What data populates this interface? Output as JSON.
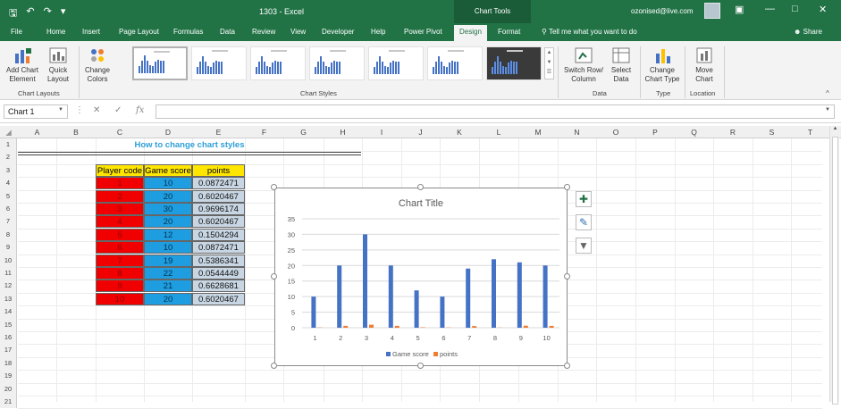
{
  "window": {
    "title": "1303 - Excel",
    "context_tab": "Chart Tools",
    "user_email": "ozonised@live.com",
    "share_label": "Share"
  },
  "tabs": [
    "File",
    "Home",
    "Insert",
    "Page Layout",
    "Formulas",
    "Data",
    "Review",
    "View",
    "Developer",
    "Help",
    "Power Pivot",
    "Design",
    "Format"
  ],
  "active_tab": "Design",
  "tell_me": "Tell me what you want to do",
  "ribbon": {
    "add_chart_element": "Add Chart Element",
    "quick_layout": "Quick Layout",
    "change_colors": "Change Colors",
    "group_chart_layouts": "Chart Layouts",
    "group_chart_styles": "Chart Styles",
    "switch_row_column": "Switch Row/ Column",
    "select_data": "Select Data",
    "group_data": "Data",
    "change_chart_type": "Change Chart Type",
    "group_type": "Type",
    "move_chart": "Move Chart",
    "group_location": "Location"
  },
  "formula_bar": {
    "name_box": "Chart 1",
    "fx": "fx",
    "formula": ""
  },
  "columns": [
    "A",
    "B",
    "C",
    "D",
    "E",
    "F",
    "G",
    "H",
    "I",
    "J",
    "K",
    "L",
    "M",
    "N",
    "O",
    "P",
    "Q",
    "R",
    "S",
    "T"
  ],
  "rows": [
    "1",
    "2",
    "3",
    "4",
    "5",
    "6",
    "7",
    "8",
    "9",
    "10",
    "11",
    "12",
    "13",
    "14",
    "15",
    "16",
    "17",
    "18",
    "19",
    "20",
    "21"
  ],
  "sheet": {
    "heading": "How to change chart styles",
    "headers": [
      "Player code",
      "Game score",
      "points"
    ],
    "player_codes": [
      "1",
      "2",
      "3",
      "4",
      "5",
      "6",
      "7",
      "8",
      "9",
      "10"
    ],
    "game_scores": [
      "10",
      "20",
      "30",
      "20",
      "12",
      "10",
      "19",
      "22",
      "21",
      "20"
    ],
    "points": [
      "0.0872471",
      "0.6020467",
      "0.9696174",
      "0.6020467",
      "0.1504294",
      "0.0872471",
      "0.5386341",
      "0.0544449",
      "0.6628681",
      "0.6020467"
    ]
  },
  "colors": {
    "excel_green": "#217346",
    "series_game_score": "#4472c4",
    "series_points": "#ed7d31",
    "header_fill": "#ffe600",
    "player_fill": "#f00000",
    "score_fill": "#1e9de0",
    "points_fill": "#c8d6e3"
  },
  "chart_data": {
    "type": "bar",
    "title": "Chart Title",
    "categories": [
      "1",
      "2",
      "3",
      "4",
      "5",
      "6",
      "7",
      "8",
      "9",
      "10"
    ],
    "series": [
      {
        "name": "Game score",
        "values": [
          10,
          20,
          30,
          20,
          12,
          10,
          19,
          22,
          21,
          20
        ]
      },
      {
        "name": "points",
        "values": [
          0.0872471,
          0.6020467,
          0.9696174,
          0.6020467,
          0.1504294,
          0.0872471,
          0.5386341,
          0.0544449,
          0.6628681,
          0.6020467
        ]
      }
    ],
    "ylim": [
      0,
      35
    ],
    "yticks": [
      0,
      5,
      10,
      15,
      20,
      25,
      30,
      35
    ],
    "grid": true,
    "legend": "bottom"
  }
}
